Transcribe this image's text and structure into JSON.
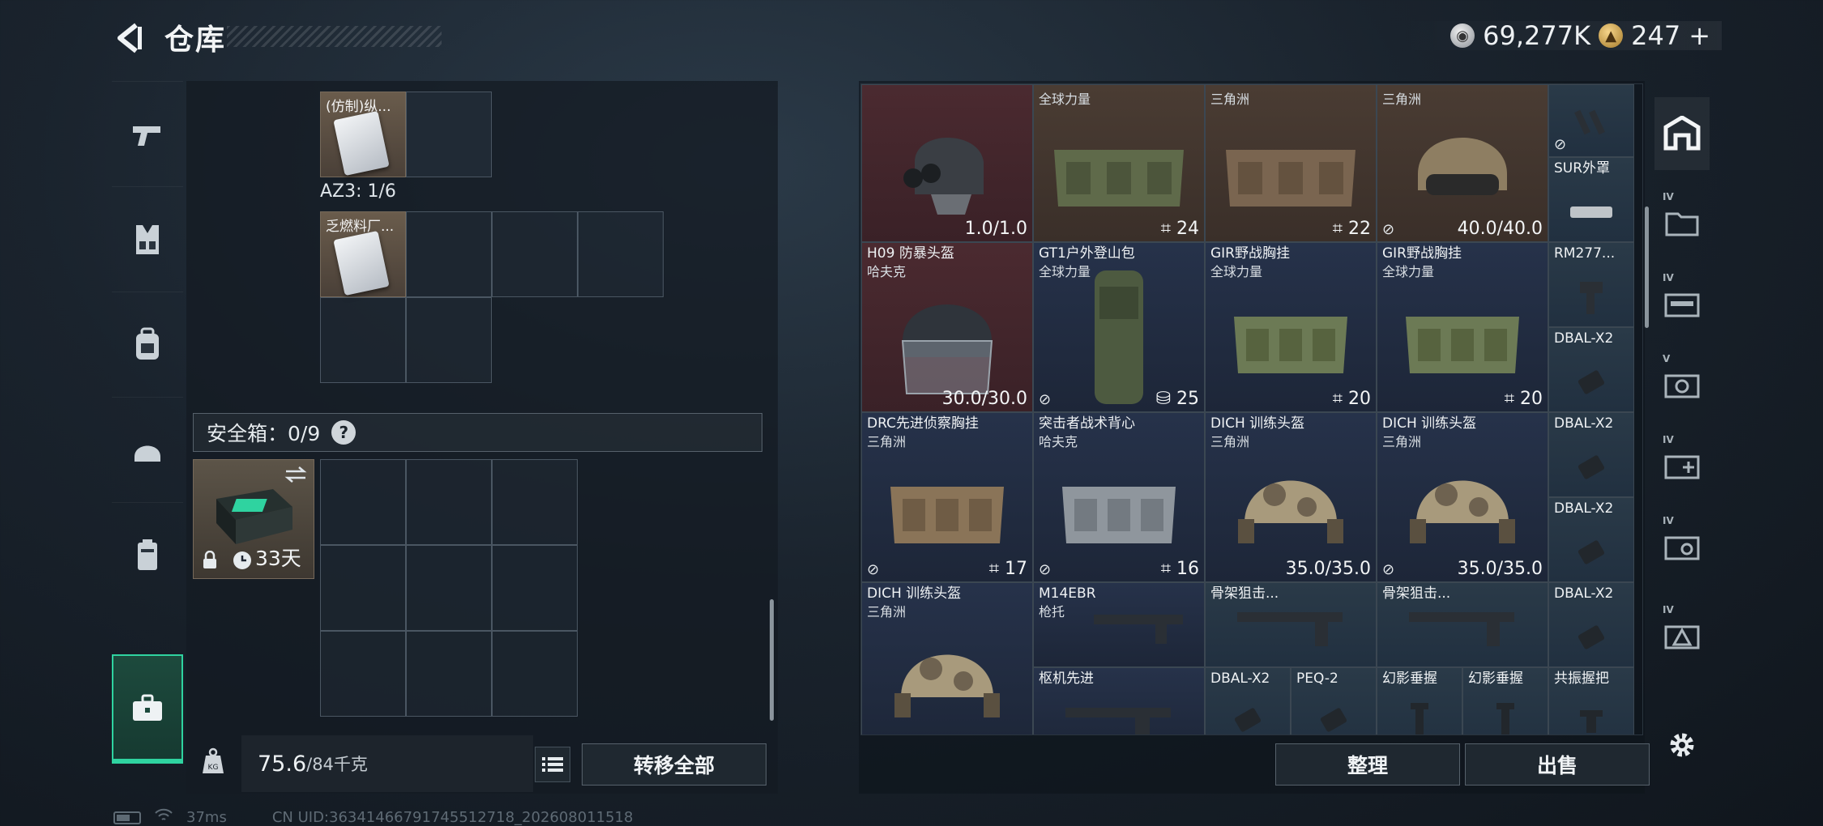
{
  "header": {
    "title": "仓库",
    "currency": {
      "silver": "69,277K",
      "gold": "247",
      "gold_plus": "+"
    }
  },
  "left_nav": {
    "items": [
      {
        "name": "weapons",
        "icon": "pistol-icon"
      },
      {
        "name": "chest-rig",
        "icon": "chest-rig-icon"
      },
      {
        "name": "backpack",
        "icon": "backpack-icon"
      },
      {
        "name": "helmet",
        "icon": "helmet-icon"
      },
      {
        "name": "armor",
        "icon": "armor-icon"
      },
      {
        "name": "safebox",
        "icon": "briefcase-icon",
        "active": true
      }
    ]
  },
  "left_panel": {
    "top_item_label": "(仿制)纵...",
    "az3_label": "AZ3: 1/6",
    "az3_item_label": "乏燃料厂...",
    "safebox_label": "安全箱：0/9",
    "safebox_help": "?",
    "safebox_duration": "33天",
    "weight_value": "75.6",
    "weight_max": "/84千克",
    "weight_unit_icon": "KG",
    "transfer_all": "转移全部"
  },
  "status_bar": {
    "ping": "37ms",
    "uid": "CN UID:36341466791745512718_202608011518"
  },
  "grid": {
    "slots": [
      {
        "id": "r0c0",
        "name": "",
        "maker": "",
        "value": "1.0/1.0",
        "color": "red"
      },
      {
        "id": "r0c1",
        "name": "",
        "maker": "全球力量",
        "value": "24"
      },
      {
        "id": "r0c2",
        "name": "",
        "maker": "三角洲",
        "value": "22"
      },
      {
        "id": "r0c3",
        "name": "",
        "maker": "三角洲",
        "value": "40.0/40.0"
      },
      {
        "id": "r0c4",
        "name": "SUR外罩",
        "maker": "",
        "value": ""
      },
      {
        "id": "r1c0",
        "name": "H09 防暴头盔",
        "maker": "哈夫克",
        "value": "30.0/30.0"
      },
      {
        "id": "r1c1",
        "name": "GT1户外登山包",
        "maker": "全球力量",
        "value": "25"
      },
      {
        "id": "r1c2",
        "name": "GIR野战胸挂",
        "maker": "全球力量",
        "value": "20"
      },
      {
        "id": "r1c3",
        "name": "GIR野战胸挂",
        "maker": "全球力量",
        "value": "20"
      },
      {
        "id": "r1c4",
        "name": "RM277...",
        "maker": "",
        "value": ""
      },
      {
        "id": "r1c4b",
        "name": "DBAL-X2",
        "maker": "",
        "value": ""
      },
      {
        "id": "r2c0",
        "name": "DRC先进侦察胸挂",
        "maker": "三角洲",
        "value": "17"
      },
      {
        "id": "r2c1",
        "name": "突击者战术背心",
        "maker": "哈夫克",
        "value": "16"
      },
      {
        "id": "r2c2",
        "name": "DICH 训练头盔",
        "maker": "三角洲",
        "value": "35.0/35.0"
      },
      {
        "id": "r2c3",
        "name": "DICH 训练头盔",
        "maker": "三角洲",
        "value": "35.0/35.0"
      },
      {
        "id": "r2c4",
        "name": "DBAL-X2",
        "maker": "",
        "value": ""
      },
      {
        "id": "r2c4b",
        "name": "DBAL-X2",
        "maker": "",
        "value": ""
      },
      {
        "id": "r3c0",
        "name": "DICH 训练头盔",
        "maker": "三角洲",
        "value": ""
      },
      {
        "id": "r3c1",
        "name": "M14EBR",
        "maker": "枪托",
        "value": ""
      },
      {
        "id": "r3c2",
        "name": "骨架狙击...",
        "maker": "",
        "value": ""
      },
      {
        "id": "r3c3",
        "name": "骨架狙击...",
        "maker": "",
        "value": ""
      },
      {
        "id": "r3c4",
        "name": "DBAL-X2",
        "maker": "",
        "value": ""
      },
      {
        "id": "r4c1",
        "name": "枢机先进",
        "maker": "",
        "value": ""
      },
      {
        "id": "r4c2a",
        "name": "DBAL-X2",
        "maker": "",
        "value": ""
      },
      {
        "id": "r4c2b",
        "name": "PEQ-2",
        "maker": "",
        "value": ""
      },
      {
        "id": "r4c3a",
        "name": "幻影垂握",
        "maker": "",
        "value": ""
      },
      {
        "id": "r4c3b",
        "name": "幻影垂握",
        "maker": "",
        "value": ""
      },
      {
        "id": "r4c4",
        "name": "共振握把",
        "maker": "",
        "value": ""
      }
    ]
  },
  "actions": {
    "sort": "整理",
    "sell": "出售"
  },
  "right_nav": {
    "items": [
      {
        "name": "warehouse-main",
        "label": "",
        "active": true
      },
      {
        "name": "warehouse-iv-1",
        "label": "IV"
      },
      {
        "name": "warehouse-iv-2",
        "label": "IV"
      },
      {
        "name": "warehouse-v",
        "label": "V"
      },
      {
        "name": "warehouse-iv-3",
        "label": "IV"
      },
      {
        "name": "warehouse-iv-4",
        "label": "IV"
      },
      {
        "name": "warehouse-iv-5",
        "label": "IV"
      }
    ]
  }
}
